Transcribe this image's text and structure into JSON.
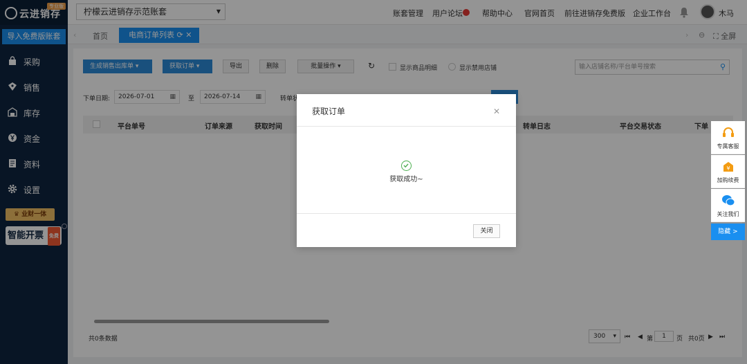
{
  "brand": {
    "name": "云进销存",
    "badge": "专业版"
  },
  "sidebar": {
    "import_label": "导入免费版账套",
    "items": [
      {
        "label": "采购",
        "icon": "shopping-bag-icon"
      },
      {
        "label": "销售",
        "icon": "sales-icon"
      },
      {
        "label": "库存",
        "icon": "warehouse-icon"
      },
      {
        "label": "资金",
        "icon": "yuan-coin-icon"
      },
      {
        "label": "资料",
        "icon": "document-icon"
      },
      {
        "label": "设置",
        "icon": "gear-icon"
      }
    ],
    "promo1": "业财一体",
    "promo2": "智能开票",
    "promo2_tag": "免费"
  },
  "topbar": {
    "account": "柠檬云进销存示范账套",
    "links": [
      "账套管理",
      "用户论坛",
      "帮助中心",
      "官网首页",
      "前往进销存免费版",
      "企业工作台"
    ],
    "user": "木马"
  },
  "tabs": {
    "home": "首页",
    "active": "电商订单列表",
    "fullscreen": "全屏"
  },
  "toolbar": {
    "generate": "生成销售出库单",
    "fetch": "获取订单",
    "export": "导出",
    "delete": "删除",
    "batch": "批量操作",
    "show_detail": "显示商品明细",
    "show_disabled": "显示禁用店铺",
    "search_placeholder": "输入店铺名称/平台单号搜索"
  },
  "filters": {
    "order_date_label": "下单日期:",
    "date_from": "2026-07-01",
    "to": "至",
    "date_to": "2026-07-14",
    "transfer_label": "转单状"
  },
  "table": {
    "columns": [
      "平台单号",
      "订单来源",
      "获取时间",
      "转单日志",
      "平台交易状态",
      "下单"
    ],
    "total": "共0条数据"
  },
  "pagination": {
    "page_size": "300",
    "page_prefix": "第",
    "page": "1",
    "page_suffix": "页",
    "total_pages": "共0页"
  },
  "dialog": {
    "title": "获取订单",
    "message": "获取成功~",
    "close": "关闭"
  },
  "float_panel": {
    "service": "专属客服",
    "renew": "加购续费",
    "follow": "关注我们",
    "hide": "隐藏 >"
  }
}
